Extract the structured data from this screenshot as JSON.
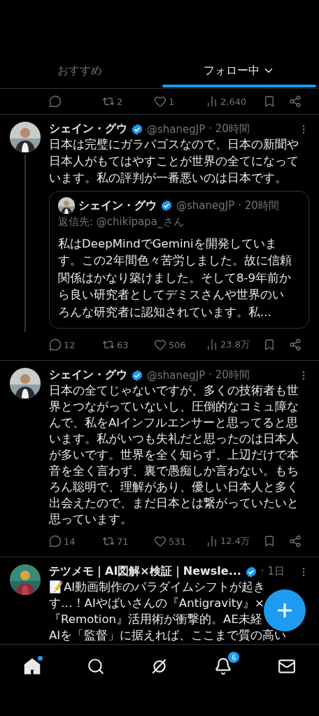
{
  "tabs": [
    {
      "label": "おすすめ",
      "selected": false
    },
    {
      "label": "フォロー中",
      "selected": true,
      "has_menu": true
    }
  ],
  "previous_actions": [
    {
      "kind": "reply"
    },
    {
      "kind": "repost",
      "count": "2"
    },
    {
      "kind": "like",
      "count": "1"
    },
    {
      "kind": "views",
      "count": "2,640"
    },
    {
      "kind": "bookmark"
    },
    {
      "kind": "share"
    }
  ],
  "tweets": [
    {
      "name": "シェイン・グウ",
      "verified": true,
      "handle": "@shanegJP",
      "time": "· 20時間",
      "thread_line": true,
      "text": "日本は完璧にガラパゴスなので、日本の新聞や日本人がもてはやすことが世界の全てになっています。私の評判が一番悪いのは日本です。",
      "quote": {
        "name": "シェイン・グウ",
        "verified": true,
        "handle": "@shanegJP",
        "time": "· 20時間",
        "reply_to": "返信先: @chikipapa_さん",
        "text": "私はDeepMindでGeminiを開発しています。この2年間色々苦労しました。故に信頼関係はかなり築けました。そして8-9年前から良い研究者としてデミスさんや世界のいろんな研究者に認知されています。私..."
      },
      "actions": [
        {
          "kind": "reply",
          "count": "12"
        },
        {
          "kind": "repost",
          "count": "63"
        },
        {
          "kind": "like",
          "count": "506"
        },
        {
          "kind": "views",
          "count": "23.8万"
        },
        {
          "kind": "bookmark"
        },
        {
          "kind": "share"
        }
      ]
    },
    {
      "name": "シェイン・グウ",
      "verified": true,
      "handle": "@shanegJP",
      "time": "· 20時間",
      "text": "日本の全てじゃないですが、多くの技術者も世界とつながっていないし、圧倒的なコミュ障なんで、私をAIインフルエンサーと思ってると思います。私がいつも失礼だと思ったのは日本人が多いです。世界を全く知らず、上辺だけで本音を全く言わず、裏で愚痴しか言わない。もちろん聡明で、理解があり、優しい日本人と多く出会えたので、まだ日本とは繋がっていたいと思っています。",
      "actions": [
        {
          "kind": "reply",
          "count": "14"
        },
        {
          "kind": "repost",
          "count": "71"
        },
        {
          "kind": "like",
          "count": "531"
        },
        {
          "kind": "views",
          "count": "12.4万"
        },
        {
          "kind": "bookmark"
        },
        {
          "kind": "share"
        }
      ]
    },
    {
      "name": "テツメモ｜AI図解×検証｜Newsle...",
      "verified": true,
      "time": "· 1日",
      "text_lines": [
        "📝AI動画制作のパラダイムシフトが起き",
        "す…！AIやばいさんの『Antigravity』×",
        "『Remotion』活用術が衝撃的。AE未経",
        "AIを「監督」に据えれば、ここまで質の高い"
      ]
    }
  ],
  "nav": [
    {
      "kind": "home",
      "selected": true,
      "dot": true
    },
    {
      "kind": "search",
      "selected": false
    },
    {
      "kind": "grok",
      "selected": false
    },
    {
      "kind": "notifications",
      "selected": false,
      "badge": "6"
    },
    {
      "kind": "messages",
      "selected": false
    }
  ]
}
